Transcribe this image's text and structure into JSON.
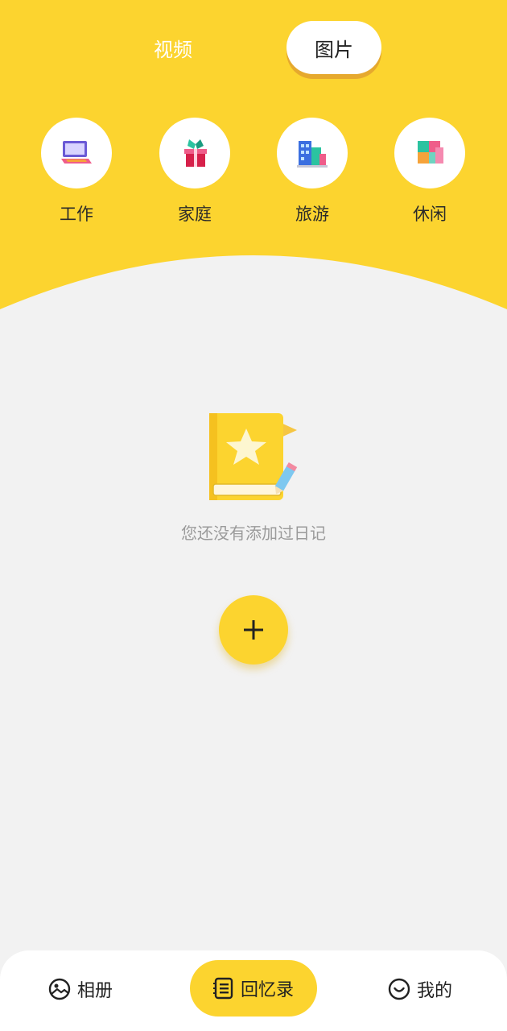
{
  "colors": {
    "accent": "#fcd42f",
    "background": "#f2f2f2",
    "surface": "#ffffff",
    "muted_text": "#9a9a9a"
  },
  "tabs": [
    {
      "label": "视频",
      "active": false
    },
    {
      "label": "图片",
      "active": true
    }
  ],
  "categories": [
    {
      "label": "工作",
      "icon": "laptop-icon"
    },
    {
      "label": "家庭",
      "icon": "gift-box-icon"
    },
    {
      "label": "旅游",
      "icon": "buildings-icon"
    },
    {
      "label": "休闲",
      "icon": "cubes-icon"
    }
  ],
  "empty_state": {
    "icon": "diary-star-icon",
    "message": "您还没有添加过日记"
  },
  "add_button": {
    "icon": "plus-icon"
  },
  "bottom_nav": [
    {
      "label": "相册",
      "icon": "album-icon",
      "active": false
    },
    {
      "label": "回忆录",
      "icon": "memo-list-icon",
      "active": true
    },
    {
      "label": "我的",
      "icon": "smile-icon",
      "active": false
    }
  ]
}
